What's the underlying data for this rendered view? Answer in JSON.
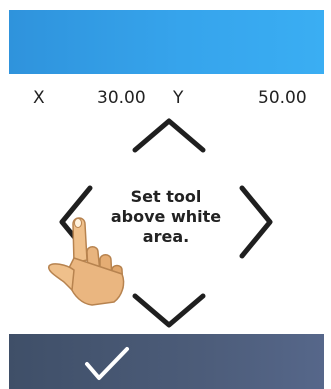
{
  "header": {
    "color": "#36a4ec"
  },
  "coords": {
    "x_label": "X",
    "x_value": "30.00",
    "y_label": "Y",
    "y_value": "50.00"
  },
  "instruction": {
    "line1": "Set tool",
    "line2": "above white",
    "line3": "area."
  },
  "icons": {
    "up": "chevron-up-icon",
    "down": "chevron-down-icon",
    "left": "chevron-left-icon",
    "right": "chevron-right-icon",
    "hand": "pointing-hand-icon",
    "confirm": "checkmark-icon"
  },
  "footer": {
    "color": "#4c5c79"
  }
}
